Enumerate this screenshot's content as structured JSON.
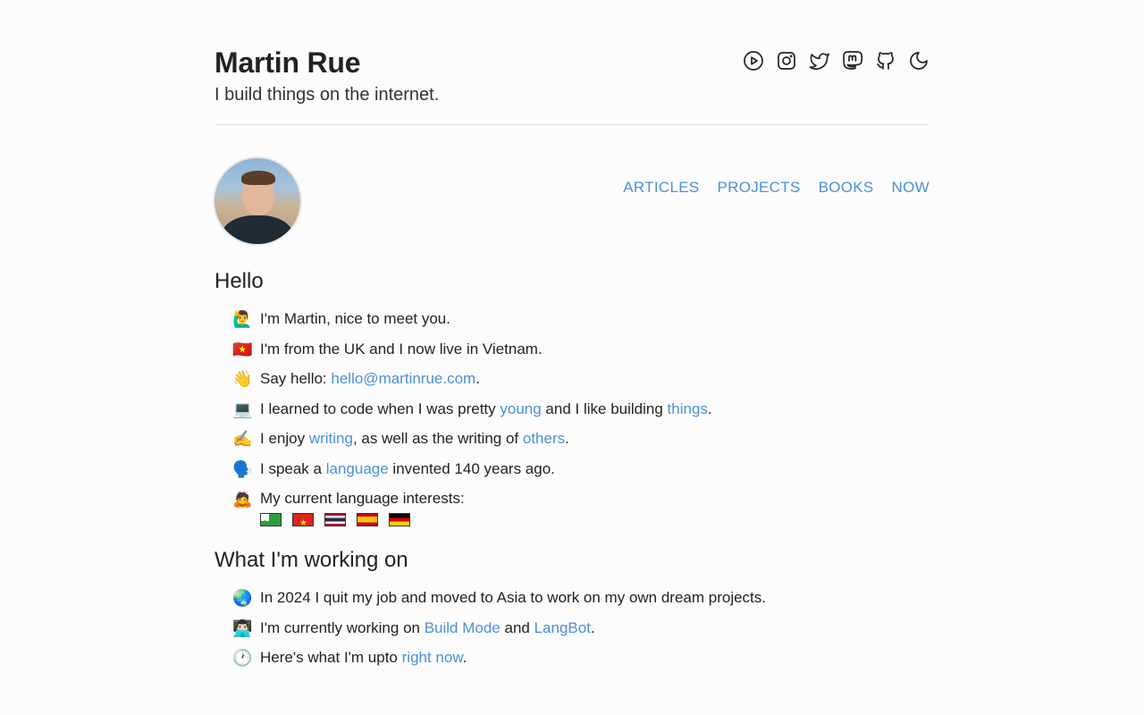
{
  "header": {
    "name": "Martin Rue",
    "tagline": "I build things on the internet."
  },
  "social_icons": [
    "youtube-icon",
    "instagram-icon",
    "twitter-icon",
    "mastodon-icon",
    "github-icon",
    "moon-icon"
  ],
  "nav": {
    "articles": "ARTICLES",
    "projects": "PROJECTS",
    "books": "BOOKS",
    "now": "NOW"
  },
  "hello": {
    "heading": "Hello",
    "items": [
      {
        "emoji": "🙋‍♂️",
        "text": "I'm Martin, nice to meet you."
      },
      {
        "emoji": "🇻🇳",
        "text": "I'm from the UK and I now live in Vietnam."
      },
      {
        "emoji": "👋",
        "pre": "Say hello: ",
        "link": "hello@martinrue.com",
        "post": "."
      },
      {
        "emoji": "💻",
        "pre": "I learned to code when I was pretty ",
        "link1": "young",
        "mid": " and I like building ",
        "link2": "things",
        "post": "."
      },
      {
        "emoji": "✍️",
        "pre": "I enjoy ",
        "link1": "writing",
        "mid": ", as well as the writing of ",
        "link2": "others",
        "post": "."
      },
      {
        "emoji": "🗣️",
        "pre": "I speak a ",
        "link": "language",
        "post": " invented 140 years ago."
      },
      {
        "emoji": "🙇",
        "text": "My current language interests:"
      }
    ],
    "flags": [
      "esperanto-flag",
      "vietnam-flag",
      "thailand-flag",
      "spain-flag",
      "germany-flag"
    ]
  },
  "working": {
    "heading": "What I'm working on",
    "items": [
      {
        "emoji": "🌏",
        "text": "In 2024 I quit my job and moved to Asia to work on my own dream projects."
      },
      {
        "emoji": "👨🏻‍💻",
        "pre": "I'm currently working on ",
        "link1": "Build Mode",
        "mid": " and ",
        "link2": "LangBot",
        "post": "."
      },
      {
        "emoji": "🕐",
        "pre": "Here's what I'm upto ",
        "link": "right now",
        "post": "."
      }
    ]
  },
  "colors": {
    "link": "#4a90d9",
    "text": "#222222",
    "background": "#fcfcfc",
    "divider": "#e1e1e1"
  }
}
